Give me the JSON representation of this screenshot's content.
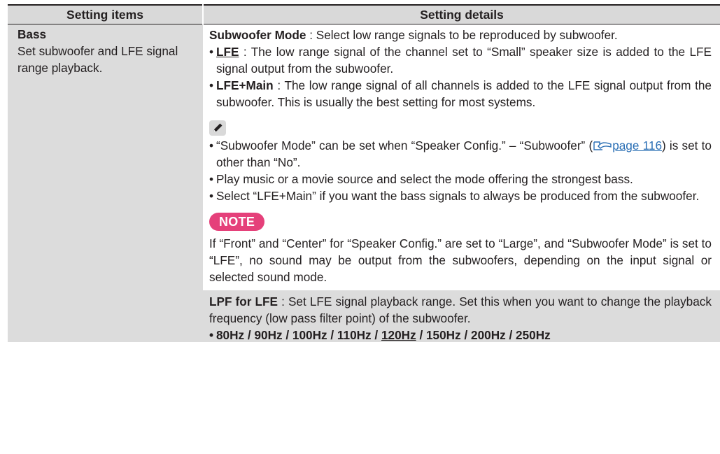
{
  "header": {
    "col1": "Setting items",
    "col2": "Setting details"
  },
  "item": {
    "title": "Bass",
    "desc": "Set subwoofer and LFE signal range playback."
  },
  "subwoofer_mode": {
    "label": "Subwoofer Mode",
    "desc": " : Select low range signals to be reproduced by subwoofer.",
    "options": [
      {
        "name": "LFE",
        "desc": " : The low range signal of the channel set to “Small” speaker size is added to the LFE signal output from the subwoofer."
      },
      {
        "name": "LFE+Main",
        "desc": " : The low range signal of all channels is added to the LFE signal output from the subwoofer. This is usually the best setting for most systems."
      }
    ]
  },
  "notes": {
    "note1_a": "“Subwoofer Mode” can be set when “Speaker Config.” – “Subwoofer” (",
    "note1_link": "page 116",
    "note1_b": ") is set to other than “No”.",
    "note2": "Play music or a movie source and select the mode offering the strongest bass.",
    "note3": "Select “LFE+Main” if you want the bass signals to always be produced from the subwoofer."
  },
  "note_badge": "NOTE",
  "note_text": "If “Front” and “Center” for “Speaker Config.” are set to “Large”, and “Subwoofer Mode” is set to “LFE”, no sound may be output from the subwoofers, depending on the input signal or selected sound mode.",
  "lpf": {
    "label": "LPF for LFE",
    "desc": " : Set LFE signal playback range. Set this when you want to change the playback frequency (low pass filter point) of the subwoofer.",
    "options": [
      "80Hz",
      "90Hz",
      "100Hz",
      "110Hz",
      "120Hz",
      "150Hz",
      "200Hz",
      "250Hz"
    ],
    "default": "120Hz"
  },
  "colors": {
    "header_bg": "#d9d9d9",
    "note_badge": "#e5407a",
    "link": "#2a6fb5"
  },
  "icons": [
    "pencil-icon",
    "page-reference-icon"
  ]
}
